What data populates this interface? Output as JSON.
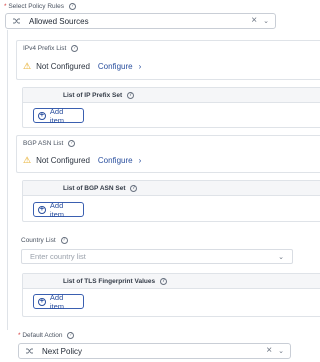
{
  "select_policy_rules": {
    "label": "Select Policy Rules",
    "required_mark": "*",
    "value": "Allowed Sources"
  },
  "ipv4_prefix_list": {
    "label": "IPv4 Prefix List",
    "status": "Not Configured",
    "configure_label": "Configure"
  },
  "ip_prefix_set": {
    "title": "List of IP Prefix Set",
    "add_label": "Add item"
  },
  "bgp_asn_list": {
    "label": "BGP ASN List",
    "status": "Not Configured",
    "configure_label": "Configure"
  },
  "bgp_asn_set": {
    "title": "List of BGP ASN Set",
    "add_label": "Add item"
  },
  "country_list": {
    "label": "Country List",
    "placeholder": "Enter country list"
  },
  "tls_fingerprint": {
    "title": "List of TLS Fingerprint Values",
    "add_label": "Add item"
  },
  "default_action": {
    "label": "Default Action",
    "required_mark": "*",
    "value": "Next Policy"
  },
  "colors": {
    "accent": "#2a4f9e",
    "warning": "#e3a008",
    "required": "#d43c3c"
  }
}
